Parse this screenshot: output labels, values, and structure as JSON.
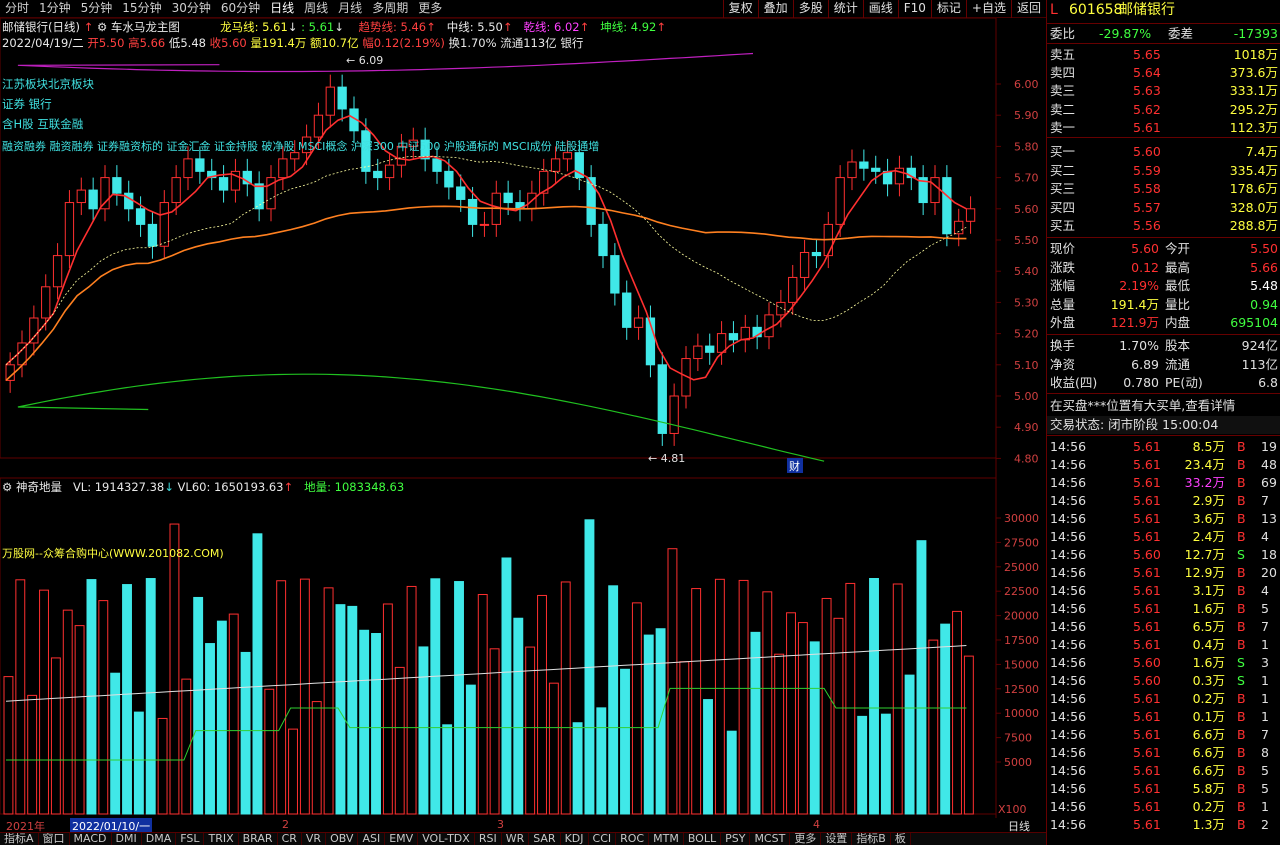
{
  "toolbar": {
    "periods": [
      "分时",
      "1分钟",
      "5分钟",
      "15分钟",
      "30分钟",
      "60分钟",
      "日线",
      "周线",
      "月线",
      "多周期",
      "更多"
    ],
    "buttons": [
      "复权",
      "叠加",
      "多股",
      "统计",
      "画线",
      "F10",
      "标记",
      "+自选",
      "返回"
    ]
  },
  "header": {
    "name": "邮储银行(日线)",
    "indicator": "车水马龙主图",
    "longma_label": "龙马线: 5.61",
    "longma2": ": 5.61",
    "trend_label": "趋势线: 5.46",
    "mid_label": "中线: 5.50",
    "qian_label": "乾线: 6.02",
    "kun_label": "坤线: 4.92",
    "date": "2022/04/19/二",
    "open": "开5.50",
    "high": "高5.66",
    "low": "低5.48",
    "close": "收5.60",
    "vol": "量191.4万",
    "amount": "额10.7亿",
    "change": "幅0.12(2.19%)",
    "turnover": "换1.70%",
    "float": "流通113亿",
    "industry": "银行"
  },
  "tags": {
    "region": "江苏板块北京板块",
    "sector": "证券        银行",
    "concept": "含H股 互联金融",
    "long": "融资融券 融资融券 证券融资标的 证金汇金 证金持股 破净股 MSCI概念 沪深300 中证500 沪股通标的 MSCI成份 陆股通增"
  },
  "price_axis": [
    "6.00",
    "5.90",
    "5.80",
    "5.70",
    "5.60",
    "5.50",
    "5.40",
    "5.30",
    "5.20",
    "5.10",
    "5.00",
    "4.90",
    "4.80"
  ],
  "vol_axis": [
    "30000",
    "27500",
    "25000",
    "22500",
    "20000",
    "17500",
    "15000",
    "12500",
    "10000",
    "7500",
    "5000"
  ],
  "annot": {
    "high": "6.09",
    "low": "4.81",
    "cai": "财",
    "unit": "X100"
  },
  "vol_header": {
    "name": "神奇地量",
    "vl": "VL: 1914327.38",
    "vl60": "VL60: 1650193.63",
    "diliang": "地量: 1083348.63",
    "watermark": "万股网--众筹合购中心(WWW.201082.COM)"
  },
  "date_axis": {
    "year": "2021年",
    "cursor": "2022/01/10/一",
    "m2": "2",
    "m3": "3",
    "m4": "4",
    "dayline": "日线"
  },
  "indicator_tabs": [
    "指标A",
    "窗口",
    "MACD",
    "DMI",
    "DMA",
    "FSL",
    "TRIX",
    "BRAR",
    "CR",
    "VR",
    "OBV",
    "ASI",
    "EMV",
    "VOL-TDX",
    "RSI",
    "WR",
    "SAR",
    "KDJ",
    "CCI",
    "ROC",
    "MTM",
    "BOLL",
    "PSY",
    "MCST",
    "更多",
    "设置",
    "指标B",
    "板"
  ],
  "panel": {
    "flag": "L",
    "code": "601658",
    "name": "邮储银行",
    "weibi_label": "委比",
    "weibi": "-29.87%",
    "weicha_label": "委差",
    "weicha": "-17393",
    "asks": [
      {
        "label": "卖五",
        "price": "5.65",
        "vol": "1018万"
      },
      {
        "label": "卖四",
        "price": "5.64",
        "vol": "373.6万"
      },
      {
        "label": "卖三",
        "price": "5.63",
        "vol": "333.1万"
      },
      {
        "label": "卖二",
        "price": "5.62",
        "vol": "295.2万"
      },
      {
        "label": "卖一",
        "price": "5.61",
        "vol": "112.3万"
      }
    ],
    "bids": [
      {
        "label": "买一",
        "price": "5.60",
        "vol": "7.4万"
      },
      {
        "label": "买二",
        "price": "5.59",
        "vol": "335.4万"
      },
      {
        "label": "买三",
        "price": "5.58",
        "vol": "178.6万"
      },
      {
        "label": "买四",
        "price": "5.57",
        "vol": "328.0万"
      },
      {
        "label": "买五",
        "price": "5.56",
        "vol": "288.8万"
      }
    ],
    "stats": [
      {
        "l1": "现价",
        "v1": "5.60",
        "l2": "今开",
        "v2": "5.50"
      },
      {
        "l1": "涨跌",
        "v1": "0.12",
        "l2": "最高",
        "v2": "5.66"
      },
      {
        "l1": "涨幅",
        "v1": "2.19%",
        "l2": "最低",
        "v2": "5.48"
      },
      {
        "l1": "总量",
        "v1": "191.4万",
        "l2": "量比",
        "v2": "0.94"
      },
      {
        "l1": "外盘",
        "v1": "121.9万",
        "l2": "内盘",
        "v2": "695104"
      }
    ],
    "stats2": [
      {
        "l1": "换手",
        "v1": "1.70%",
        "l2": "股本",
        "v2": "924亿"
      },
      {
        "l1": "净资",
        "v1": "6.89",
        "l2": "流通",
        "v2": "113亿"
      },
      {
        "l1": "收益(四)",
        "v1": "0.780",
        "l2": "PE(动)",
        "v2": "6.8"
      }
    ],
    "notice": "在买盘***位置有大买单,查看详情",
    "status": "交易状态: 闭市阶段 15:00:04",
    "ticks": [
      {
        "t": "14:56",
        "p": "5.61",
        "v": "8.5万",
        "s": "B",
        "n": "19"
      },
      {
        "t": "14:56",
        "p": "5.61",
        "v": "23.4万",
        "s": "B",
        "n": "48"
      },
      {
        "t": "14:56",
        "p": "5.61",
        "v": "33.2万",
        "s": "B",
        "n": "69"
      },
      {
        "t": "14:56",
        "p": "5.61",
        "v": "2.9万",
        "s": "B",
        "n": "7"
      },
      {
        "t": "14:56",
        "p": "5.61",
        "v": "3.6万",
        "s": "B",
        "n": "13"
      },
      {
        "t": "14:56",
        "p": "5.61",
        "v": "2.4万",
        "s": "B",
        "n": "4"
      },
      {
        "t": "14:56",
        "p": "5.60",
        "v": "12.7万",
        "s": "S",
        "n": "18"
      },
      {
        "t": "14:56",
        "p": "5.61",
        "v": "12.9万",
        "s": "B",
        "n": "20"
      },
      {
        "t": "14:56",
        "p": "5.61",
        "v": "3.1万",
        "s": "B",
        "n": "4"
      },
      {
        "t": "14:56",
        "p": "5.61",
        "v": "1.6万",
        "s": "B",
        "n": "5"
      },
      {
        "t": "14:56",
        "p": "5.61",
        "v": "6.5万",
        "s": "B",
        "n": "7"
      },
      {
        "t": "14:56",
        "p": "5.61",
        "v": "0.4万",
        "s": "B",
        "n": "1"
      },
      {
        "t": "14:56",
        "p": "5.60",
        "v": "1.6万",
        "s": "S",
        "n": "3"
      },
      {
        "t": "14:56",
        "p": "5.60",
        "v": "0.3万",
        "s": "S",
        "n": "1"
      },
      {
        "t": "14:56",
        "p": "5.61",
        "v": "0.2万",
        "s": "B",
        "n": "1"
      },
      {
        "t": "14:56",
        "p": "5.61",
        "v": "0.1万",
        "s": "B",
        "n": "1"
      },
      {
        "t": "14:56",
        "p": "5.61",
        "v": "6.6万",
        "s": "B",
        "n": "7"
      },
      {
        "t": "14:56",
        "p": "5.61",
        "v": "6.6万",
        "s": "B",
        "n": "8"
      },
      {
        "t": "14:56",
        "p": "5.61",
        "v": "6.6万",
        "s": "B",
        "n": "5"
      },
      {
        "t": "14:56",
        "p": "5.61",
        "v": "5.8万",
        "s": "B",
        "n": "5"
      },
      {
        "t": "14:56",
        "p": "5.61",
        "v": "0.2万",
        "s": "B",
        "n": "1"
      },
      {
        "t": "14:56",
        "p": "5.61",
        "v": "1.3万",
        "s": "B",
        "n": "2"
      }
    ]
  },
  "colors": {
    "up": "#ff3030",
    "down": "#40e8e8",
    "bg": "#000000",
    "grid": "#600000"
  }
}
